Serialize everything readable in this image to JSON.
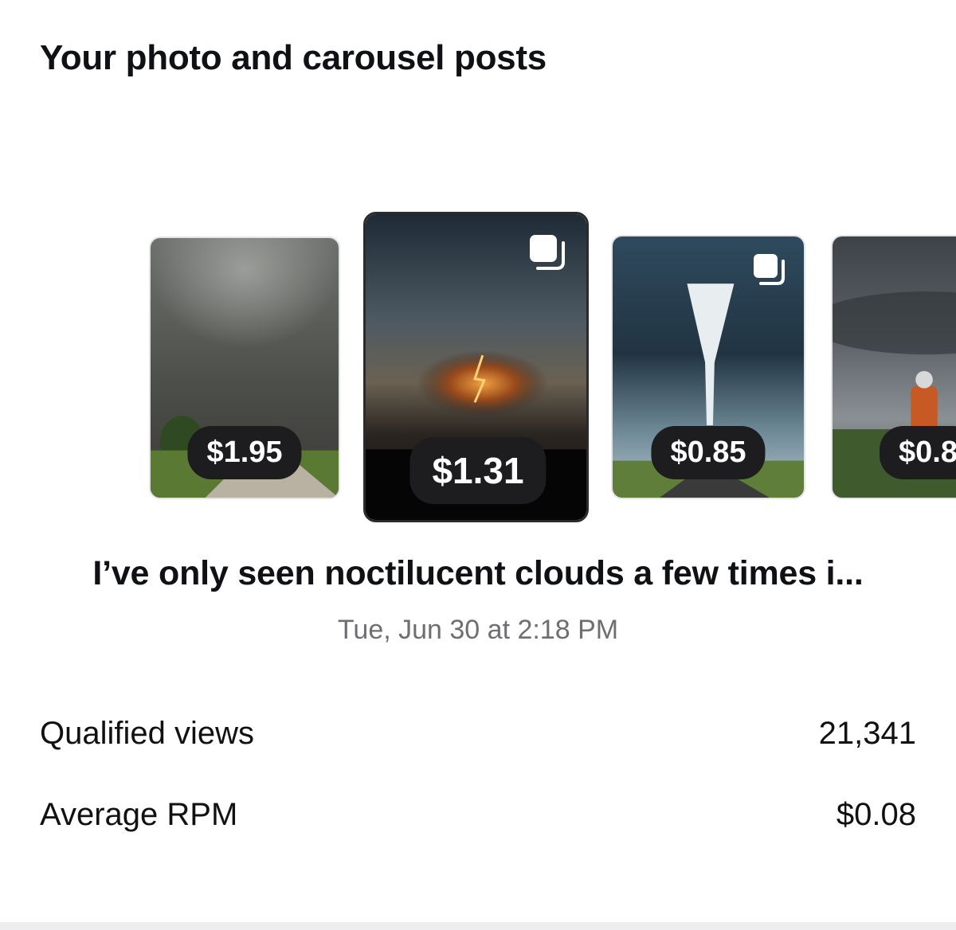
{
  "section": {
    "title": "Your photo and carousel posts"
  },
  "posts": [
    {
      "price": "$1.95",
      "thumbnail": "tornado-debris-field-photo",
      "icon": "none"
    },
    {
      "price": "$1.31",
      "thumbnail": "lightning-cloud-sunset-photo",
      "icon": "carousel-stack-icon",
      "selected": true
    },
    {
      "price": "$0.85",
      "thumbnail": "white-tornado-road-photo",
      "icon": "carousel-stack-icon"
    },
    {
      "price": "$0.8",
      "thumbnail": "storm-chaser-supercell-photo",
      "icon": "none"
    }
  ],
  "selected_post": {
    "caption": "I’ve only seen noctilucent clouds a few times i...",
    "date": "Tue, Jun 30 at 2:18 PM"
  },
  "stats": [
    {
      "label": "Qualified views",
      "value": "21,341"
    },
    {
      "label": "Average RPM",
      "value": "$0.08"
    }
  ],
  "colors": {
    "badge_bg": "#1d1d1f",
    "badge_text": "#ffffff",
    "muted_text": "#6e6e73"
  }
}
